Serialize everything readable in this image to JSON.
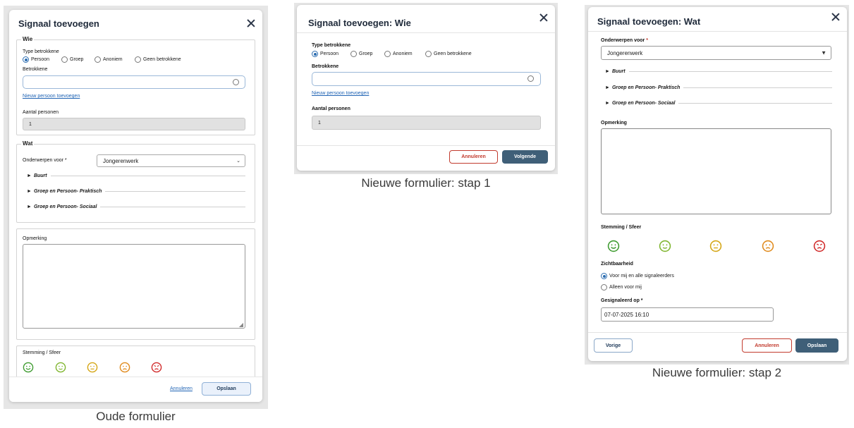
{
  "old": {
    "title": "Signaal toevoegen",
    "wie_legend": "Wie",
    "type_label": "Type betrokkene",
    "radios": [
      "Persoon",
      "Groep",
      "Anoniem",
      "Geen betrokkene"
    ],
    "betrokkene_label": "Betrokkene",
    "new_person_link": "Nieuw persoon toevoegen",
    "aantal_label": "Aantal personen",
    "aantal_value": "1",
    "wat_legend": "Wat",
    "onderwerpen_label": "Onderwerpen voor *",
    "onderwerpen_value": "Jongerenwerk",
    "collapsibles": [
      "Buurt",
      "Groep en Persoon- Praktisch",
      "Groep en Persoon- Sociaal"
    ],
    "opmerking_label": "Opmerking",
    "stemming_label": "Stemming / Sfeer",
    "cancel_label": "Annuleren",
    "save_label": "Opslaan",
    "caption": "Oude formulier"
  },
  "step1": {
    "title": "Signaal toevoegen: Wie",
    "type_label": "Type betrokkene",
    "radios": [
      "Persoon",
      "Groep",
      "Anoniem",
      "Geen betrokkene"
    ],
    "betrokkene_label": "Betrokkene",
    "new_person_link": "Nieuw persoon toevoegen",
    "aantal_label": "Aantal personen",
    "aantal_value": "1",
    "cancel_label": "Annuleren",
    "next_label": "Volgende",
    "caption": "Nieuwe formulier: stap 1"
  },
  "step2": {
    "title": "Signaal toevoegen: Wat",
    "onderwerpen_label": "Onderwerpen voor",
    "required_mark": "*",
    "onderwerpen_value": "Jongerenwerk",
    "collapsibles": [
      "Buurt",
      "Groep en Persoon- Praktisch",
      "Groep en Persoon- Sociaal"
    ],
    "opmerking_label": "Opmerking",
    "stemming_label": "Stemming / Sfeer",
    "zichtbaarheid_label": "Zichtbaarheid",
    "zicht_options": [
      "Voor mij en alle signaleerders",
      "Alleen voor mij"
    ],
    "gesignaleerd_label": "Gesignaleerd op *",
    "gesignaleerd_value": "07-07-2025 16:10",
    "prev_label": "Vorige",
    "cancel_label": "Annuleren",
    "save_label": "Opslaan",
    "caption": "Nieuwe formulier: stap 2"
  },
  "colors": {
    "face_green": "#3e9b2f",
    "face_lightgreen": "#7fb52e",
    "face_yellow": "#d4a514",
    "face_orange": "#e08a1c",
    "face_red": "#d12a2a",
    "primary": "#3f5f78",
    "danger": "#c23b2e",
    "link": "#2265b5"
  },
  "icons": {
    "close": "close-icon",
    "chevron": "chevron-down-icon",
    "mood": [
      "very-happy-face-icon",
      "happy-face-icon",
      "neutral-face-icon",
      "sad-face-icon",
      "angry-face-icon"
    ]
  }
}
